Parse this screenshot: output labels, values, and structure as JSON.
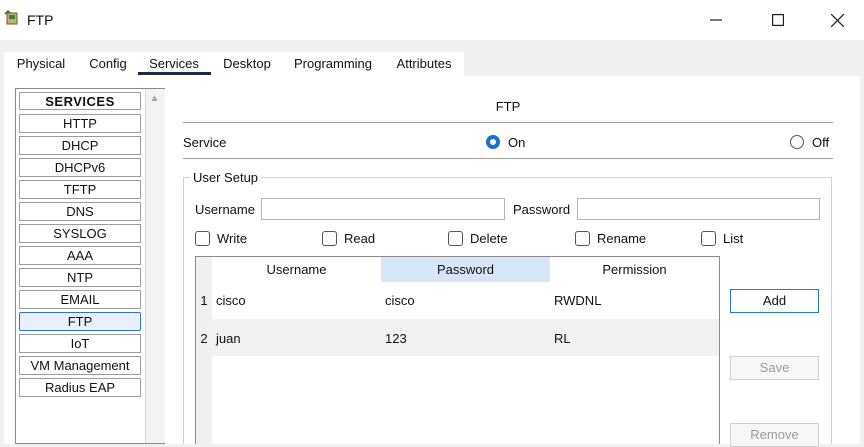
{
  "window": {
    "title": "FTP",
    "app_icon": "packet-tracer-icon",
    "controls": [
      "minimize-icon",
      "maximize-icon",
      "close-icon"
    ]
  },
  "tabs": [
    {
      "label": "Physical"
    },
    {
      "label": "Config"
    },
    {
      "label": "Services",
      "active": true
    },
    {
      "label": "Desktop"
    },
    {
      "label": "Programming"
    },
    {
      "label": "Attributes"
    }
  ],
  "sidebar": {
    "header": "SERVICES",
    "items": [
      "HTTP",
      "DHCP",
      "DHCPv6",
      "TFTP",
      "DNS",
      "SYSLOG",
      "AAA",
      "NTP",
      "EMAIL",
      "FTP",
      "IoT",
      "VM Management",
      "Radius EAP"
    ],
    "selected": "FTP"
  },
  "ftp": {
    "title": "FTP",
    "service_label": "Service",
    "on_label": "On",
    "off_label": "Off",
    "service_state": "On"
  },
  "user_setup": {
    "legend": "User Setup",
    "username_label": "Username",
    "username_value": "",
    "password_label": "Password",
    "password_value": "",
    "permissions": [
      {
        "label": "Write",
        "checked": false
      },
      {
        "label": "Read",
        "checked": false
      },
      {
        "label": "Delete",
        "checked": false
      },
      {
        "label": "Rename",
        "checked": false
      },
      {
        "label": "List",
        "checked": false
      }
    ]
  },
  "table": {
    "columns": [
      "Username",
      "Password",
      "Permission"
    ],
    "rows": [
      {
        "num": "1",
        "username": "cisco",
        "password": "cisco",
        "permission": "RWDNL"
      },
      {
        "num": "2",
        "username": "juan",
        "password": "123",
        "permission": "RL"
      }
    ]
  },
  "buttons": {
    "add": "Add",
    "save": "Save",
    "remove": "Remove"
  },
  "colors": {
    "accent": "#1b6ed6",
    "selected_bg": "#e7f0fb",
    "header_highlight": "#d6e6f6",
    "tab_underline": "#1b2a45"
  }
}
